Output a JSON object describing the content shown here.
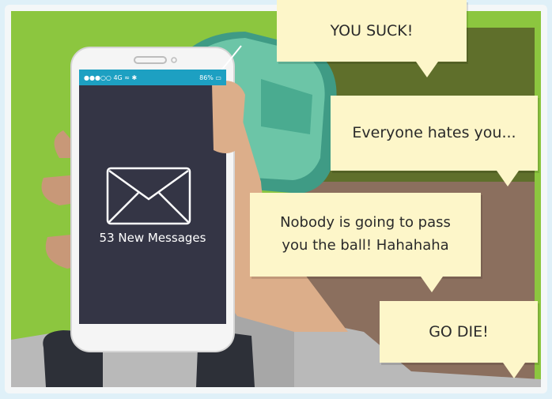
{
  "phone": {
    "status_left": "●●●○○ 4G ≈ ✱",
    "status_right": "86%",
    "messages_label": "53 New Messages"
  },
  "bubbles": [
    {
      "text": "YOU SUCK!"
    },
    {
      "text": "Everyone hates you..."
    },
    {
      "text": "Nobody is going to pass you the ball! Hahahaha"
    },
    {
      "text": "GO DIE!"
    }
  ],
  "colors": {
    "grass": "#8cc63f",
    "screen": "#343545",
    "bubble": "#fdf6c9",
    "status_bar": "#1da0c2"
  }
}
